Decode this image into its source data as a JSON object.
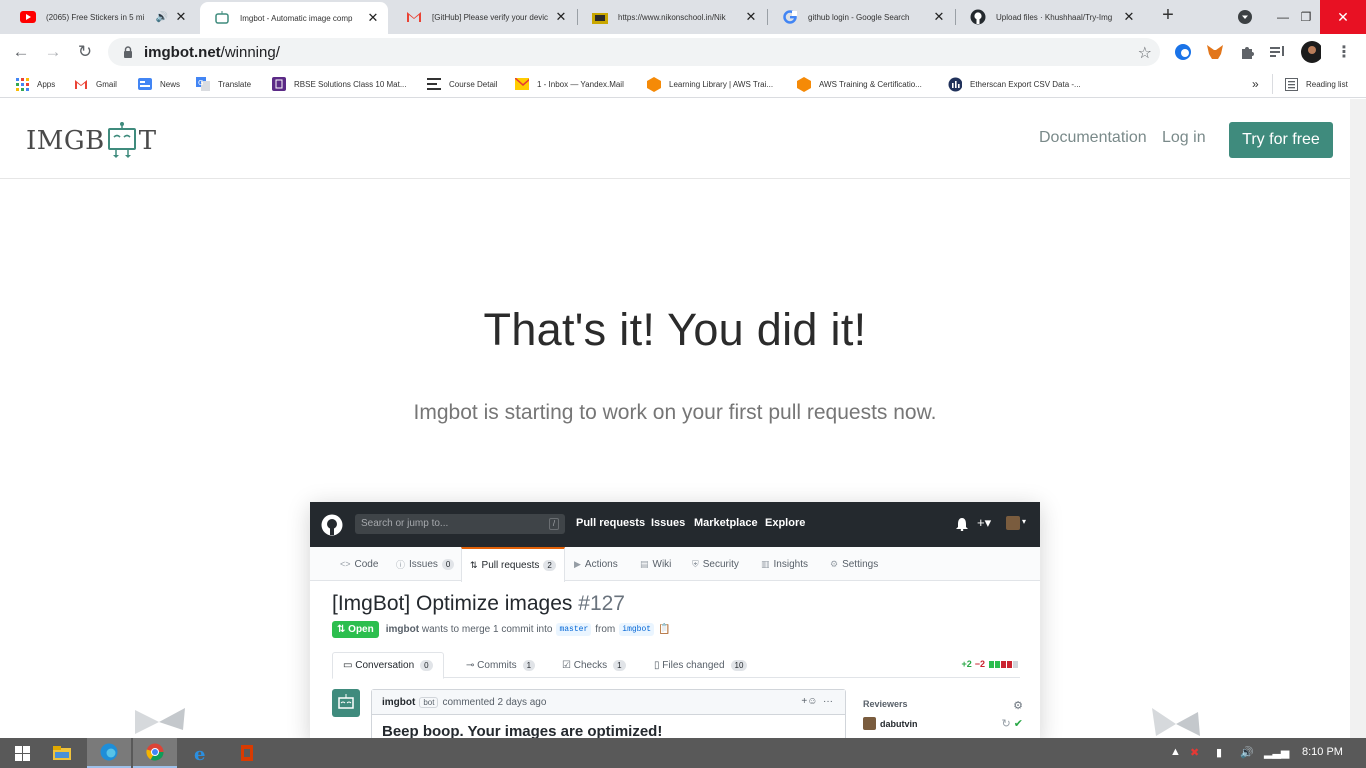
{
  "browser": {
    "tabs": [
      {
        "title": "(2065) Free Stickers in 5 mi",
        "icon": "youtube-icon"
      },
      {
        "title": "Imgbot - Automatic image comp",
        "icon": "imgbot-icon",
        "active": true
      },
      {
        "title": "[GitHub] Please verify your devic",
        "icon": "gmail-icon"
      },
      {
        "title": "https://www.nikonschool.in/Nik",
        "icon": "folder-icon"
      },
      {
        "title": "github login - Google Search",
        "icon": "google-icon"
      },
      {
        "title": "Upload files · Khushhaal/Try-Img",
        "icon": "github-icon"
      }
    ],
    "url_host": "imgbot.net",
    "url_path": "/winning/",
    "bookmarks": [
      {
        "label": "Apps"
      },
      {
        "label": "Gmail"
      },
      {
        "label": "News"
      },
      {
        "label": "Translate"
      },
      {
        "label": "RBSE Solutions Class 10 Mat..."
      },
      {
        "label": "Course Detail"
      },
      {
        "label": "1 - Inbox — Yandex.Mail"
      },
      {
        "label": "Learning Library | AWS Trai..."
      },
      {
        "label": "AWS Training & Certificatio..."
      },
      {
        "label": "Etherscan Export CSV Data -..."
      }
    ],
    "reading_list": "Reading list",
    "overflow": "»"
  },
  "site": {
    "logo_text_left": "IMGB",
    "logo_text_right": "T",
    "nav_documentation": "Documentation",
    "nav_login": "Log in",
    "cta": "Try for free",
    "headline": "That's it! You did it!",
    "subline": "Imgbot is starting to work on your first pull requests now."
  },
  "github": {
    "search_placeholder": "Search or jump to...",
    "search_key": "/",
    "nav": [
      "Pull requests",
      "Issues",
      "Marketplace",
      "Explore"
    ],
    "repo_tabs": [
      {
        "label": "Code",
        "count": ""
      },
      {
        "label": "Issues",
        "count": "0"
      },
      {
        "label": "Pull requests",
        "count": "2"
      },
      {
        "label": "Actions",
        "count": ""
      },
      {
        "label": "Wiki",
        "count": ""
      },
      {
        "label": "Security",
        "count": ""
      },
      {
        "label": "Insights",
        "count": ""
      },
      {
        "label": "Settings",
        "count": ""
      }
    ],
    "pr_title": "[ImgBot] Optimize images",
    "pr_number": "#127",
    "status": "Open",
    "author": "imgbot",
    "merge_text": "wants to merge 1 commit into",
    "base_branch": "master",
    "from_text": "from",
    "head_branch": "imgbot",
    "pr_tabs": [
      {
        "label": "Conversation",
        "count": "0"
      },
      {
        "label": "Commits",
        "count": "1"
      },
      {
        "label": "Checks",
        "count": "1"
      },
      {
        "label": "Files changed",
        "count": "10"
      }
    ],
    "diff_add": "+2",
    "diff_del": "−2",
    "comment_author": "imgbot",
    "comment_badge": "bot",
    "comment_time": "commented 2 days ago",
    "comment_body": "Beep boop. Your images are optimized!",
    "reviewers_label": "Reviewers",
    "reviewer": "dabutvin"
  },
  "taskbar": {
    "clock": "8:10 PM"
  },
  "colors": {
    "brand": "#3f8b7d",
    "github_dark": "#24292e",
    "open_green": "#2cbe4e"
  }
}
